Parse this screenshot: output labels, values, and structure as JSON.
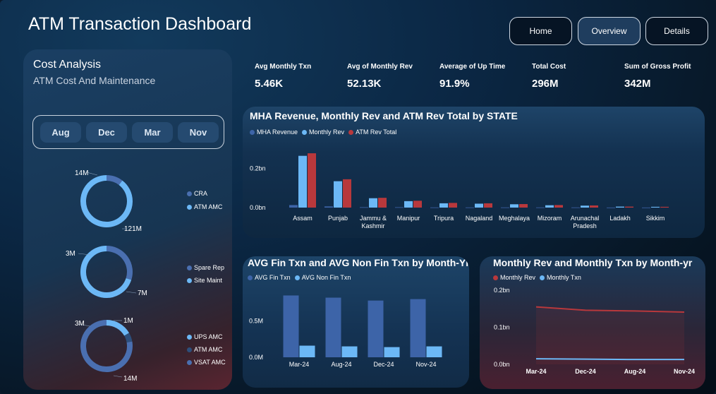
{
  "header": {
    "title": "ATM Transaction Dashboard"
  },
  "nav": {
    "home": "Home",
    "overview": "Overview",
    "details": "Details"
  },
  "cost_panel": {
    "title": "Cost Analysis",
    "subtitle": "ATM Cost And Maintenance",
    "months": [
      "Aug",
      "Dec",
      "Mar",
      "Nov"
    ]
  },
  "donuts": [
    {
      "labels": [
        "14M",
        "121M"
      ],
      "legend": [
        "CRA",
        "ATM AMC"
      ],
      "values": [
        14,
        121
      ],
      "colors": [
        "#4a6fb0",
        "#6cb8f6"
      ]
    },
    {
      "labels": [
        "3M",
        "7M"
      ],
      "legend": [
        "Spare Rep",
        "Site Maint"
      ],
      "values": [
        3,
        7
      ],
      "colors": [
        "#4a6fb0",
        "#6cb8f6"
      ]
    },
    {
      "labels": [
        "3M",
        "1M",
        "14M"
      ],
      "legend": [
        "UPS AMC",
        "ATM AMC",
        "VSAT AMC"
      ],
      "values": [
        3,
        1,
        14
      ],
      "colors": [
        "#6cb8f6",
        "#2d4f7c",
        "#4a6fb0"
      ]
    }
  ],
  "kpis": [
    {
      "label": "Avg Monthly Txn",
      "value": "5.46K"
    },
    {
      "label": "Avg of Monthly Rev",
      "value": "52.13K"
    },
    {
      "label": "Average of Up Time",
      "value": "91.9%"
    },
    {
      "label": "Total Cost",
      "value": "296M"
    },
    {
      "label": "Sum of Gross Profit",
      "value": "342M"
    }
  ],
  "colors": {
    "dark_blue": "#3d64a8",
    "light_blue": "#6cb8f6",
    "red": "#b8383c"
  },
  "chart_data": [
    {
      "type": "bar",
      "title": "MHA Revenue, Monthly Rev and ATM Rev Total by STATE",
      "categories": [
        "Assam",
        "Punjab",
        "Jammu & Kashmir",
        "Manipur",
        "Tripura",
        "Nagaland",
        "Meghalaya",
        "Mizoram",
        "Arunachal Pradesh",
        "Ladakh",
        "Sikkim"
      ],
      "series": [
        {
          "name": "MHA Revenue",
          "values": [
            0.013,
            0.006,
            0.002,
            0.002,
            0.001,
            0.001,
            0.001,
            0.001,
            0.001,
            0.0005,
            0.0005
          ]
        },
        {
          "name": "Monthly Rev",
          "values": [
            0.265,
            0.135,
            0.048,
            0.033,
            0.022,
            0.02,
            0.017,
            0.012,
            0.01,
            0.005,
            0.004
          ]
        },
        {
          "name": "ATM Rev Total",
          "values": [
            0.278,
            0.145,
            0.05,
            0.035,
            0.024,
            0.022,
            0.018,
            0.013,
            0.011,
            0.005,
            0.004
          ]
        }
      ],
      "yticks": [
        "0.0bn",
        "0.2bn"
      ],
      "ylim": [
        0,
        0.3
      ]
    },
    {
      "type": "bar",
      "title": "AVG Fin Txn and AVG Non Fin Txn by Month-Yr",
      "categories": [
        "Mar-24",
        "Aug-24",
        "Dec-24",
        "Nov-24"
      ],
      "series": [
        {
          "name": "AVG Fin Txn",
          "values": [
            0.85,
            0.82,
            0.78,
            0.8
          ]
        },
        {
          "name": "AVG Non Fin Txn",
          "values": [
            0.16,
            0.15,
            0.14,
            0.15
          ]
        }
      ],
      "yticks": [
        "0.0M",
        "0.5M"
      ],
      "ylim": [
        0,
        1.0
      ]
    },
    {
      "type": "line",
      "title": "Monthly Rev and Monthly Txn by Month-yr",
      "categories": [
        "Mar-24",
        "Dec-24",
        "Aug-24",
        "Nov-24"
      ],
      "series": [
        {
          "name": "Monthly Rev",
          "values": [
            0.155,
            0.146,
            0.144,
            0.141
          ]
        },
        {
          "name": "Monthly Txn",
          "values": [
            0.015,
            0.014,
            0.013,
            0.013
          ]
        }
      ],
      "yticks": [
        "0.0bn",
        "0.1bn",
        "0.2bn"
      ],
      "ylim": [
        0,
        0.2
      ]
    }
  ]
}
